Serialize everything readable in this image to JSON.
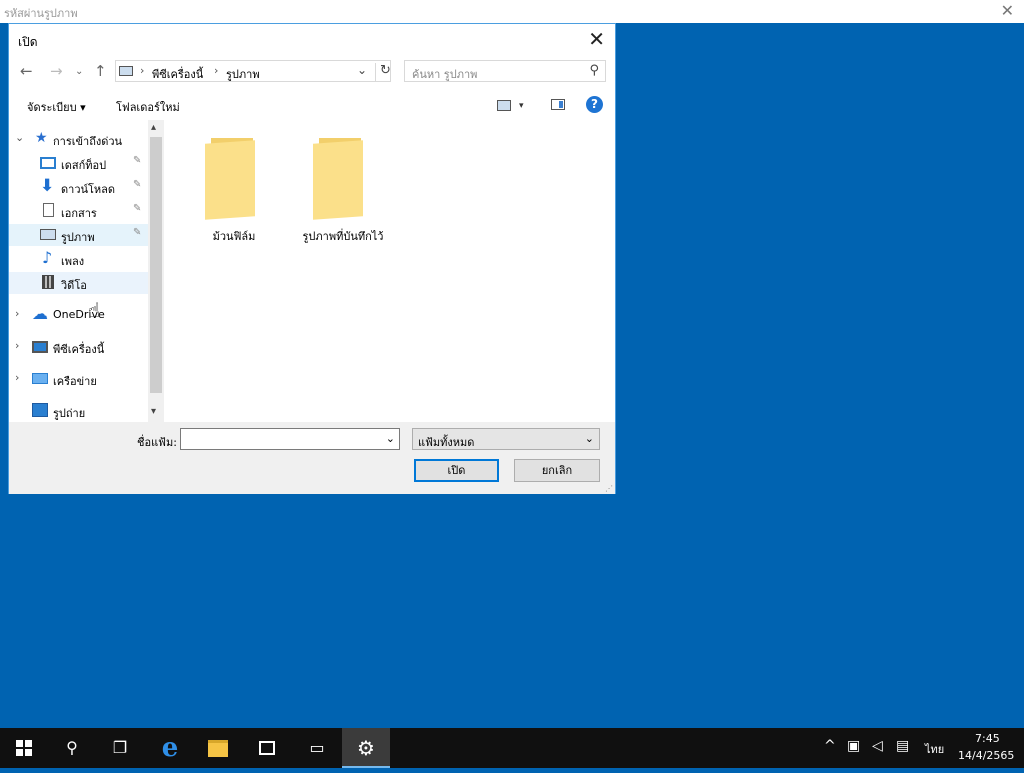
{
  "background_window": {
    "title": "รหัสผ่านรูปภาพ",
    "close_glyph": "✕"
  },
  "dialog": {
    "title": "เปิด",
    "close_glyph": "✕",
    "nav": {
      "back": "←",
      "forward": "→",
      "recent": "⌄",
      "up": "↑"
    },
    "address": {
      "crumbs": [
        "พีซีเครื่องนี้",
        "รูปภาพ"
      ],
      "separator": "›",
      "dropdown": "⌄",
      "refresh": "↻"
    },
    "search": {
      "placeholder": "ค้นหา รูปภาพ",
      "icon": "search-icon"
    },
    "commands": {
      "organize": "จัดระเบียบ ▾",
      "new_folder": "โฟลเดอร์ใหม่",
      "view_caret": "▾",
      "help": "?"
    },
    "nav_pane": {
      "quick_access": "การเข้าถึงด่วน",
      "items": [
        {
          "label": "เดสก์ท็อป",
          "icon": "desktop-icon",
          "pinned": true
        },
        {
          "label": "ดาวน์โหลด",
          "icon": "download-icon",
          "pinned": true
        },
        {
          "label": "เอกสาร",
          "icon": "document-icon",
          "pinned": true
        },
        {
          "label": "รูปภาพ",
          "icon": "pictures-icon",
          "pinned": true,
          "selected": true
        },
        {
          "label": "เพลง",
          "icon": "music-icon",
          "pinned": false
        },
        {
          "label": "วิดีโอ",
          "icon": "video-icon",
          "pinned": false,
          "hover": true
        }
      ],
      "roots": [
        {
          "label": "OneDrive",
          "icon": "onedrive-icon"
        },
        {
          "label": "พีซีเครื่องนี้",
          "icon": "this-pc-icon"
        },
        {
          "label": "เครือข่าย",
          "icon": "network-icon"
        },
        {
          "label": "รูปถ่าย",
          "icon": "photos-icon"
        }
      ],
      "pin_glyph": "📌",
      "expand_glyph": "›",
      "collapse_glyph": "⌄"
    },
    "folders": [
      {
        "label": "ม้วนฟิล์ม"
      },
      {
        "label": "รูปภาพที่บันทึกไว้"
      }
    ],
    "bottom": {
      "filename_label": "ชื่อแฟ้ม:",
      "filename_value": "",
      "filetype": "แฟ้มทั้งหมด",
      "open": "เปิด",
      "cancel": "ยกเลิก"
    }
  },
  "taskbar": {
    "tray_language": "ไทย",
    "time": "7:45",
    "date": "14/4/2565"
  },
  "colors": {
    "desktop": "#0063b1",
    "accent": "#0078d7",
    "taskbar": "#101010"
  }
}
